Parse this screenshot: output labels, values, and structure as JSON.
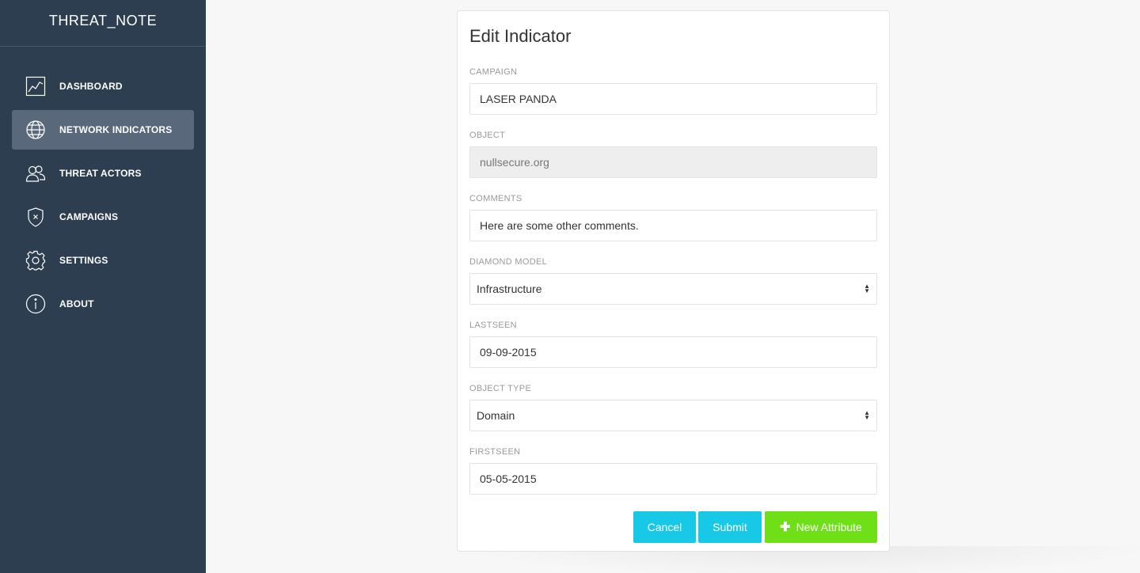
{
  "app": {
    "title": "THREAT_NOTE"
  },
  "sidebar": {
    "items": [
      {
        "label": "DASHBOARD",
        "icon": "chart-line-icon",
        "active": false
      },
      {
        "label": "NETWORK INDICATORS",
        "icon": "globe-icon",
        "active": true
      },
      {
        "label": "THREAT ACTORS",
        "icon": "users-icon",
        "active": false
      },
      {
        "label": "CAMPAIGNS",
        "icon": "shield-x-icon",
        "active": false
      },
      {
        "label": "SETTINGS",
        "icon": "gear-icon",
        "active": false
      },
      {
        "label": "ABOUT",
        "icon": "info-icon",
        "active": false
      }
    ]
  },
  "form": {
    "title": "Edit Indicator",
    "campaign": {
      "label": "CAMPAIGN",
      "value": "LASER PANDA"
    },
    "object": {
      "label": "OBJECT",
      "value": "nullsecure.org"
    },
    "comments": {
      "label": "COMMENTS",
      "value": "Here are some other comments."
    },
    "diamond_model": {
      "label": "DIAMOND MODEL",
      "value": "Infrastructure"
    },
    "lastseen": {
      "label": "LASTSEEN",
      "value": "09-09-2015"
    },
    "object_type": {
      "label": "OBJECT TYPE",
      "value": "Domain"
    },
    "firstseen": {
      "label": "FIRSTSEEN",
      "value": "05-05-2015"
    }
  },
  "buttons": {
    "cancel": "Cancel",
    "submit": "Submit",
    "new_attribute": "New Attribute"
  },
  "colors": {
    "sidebar_bg": "#2e3e51",
    "sidebar_active": "#59687a",
    "primary_button": "#18c9e7",
    "success_button": "#6fe018"
  }
}
